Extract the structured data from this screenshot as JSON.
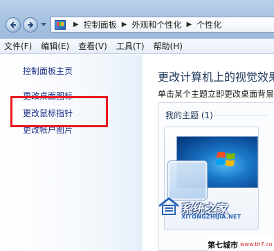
{
  "breadcrumbs": [
    "控制面板",
    "外观和个性化",
    "个性化"
  ],
  "menu": [
    "文件(F)",
    "编辑(E)",
    "查看(V)",
    "工具(T)",
    "帮助(H)"
  ],
  "left_pane": {
    "home": "控制面板主页",
    "links": [
      "更改桌面图标",
      "更改鼠标指针",
      "更改帐户图片"
    ]
  },
  "main": {
    "title": "更改计算机上的视觉效果",
    "description": "单击某个主题立即更改桌面背景"
  },
  "themes": {
    "group_label": "我的主题 (1)"
  },
  "watermark": {
    "name": "系统之家",
    "url": "XITONGZHIJIA.NET",
    "bottom_cn": "第七城市",
    "bottom_url": "www.th7.cn"
  },
  "colors": {
    "highlight_box": "#e8161c",
    "link": "#1e3287",
    "title": "#1e395b"
  }
}
